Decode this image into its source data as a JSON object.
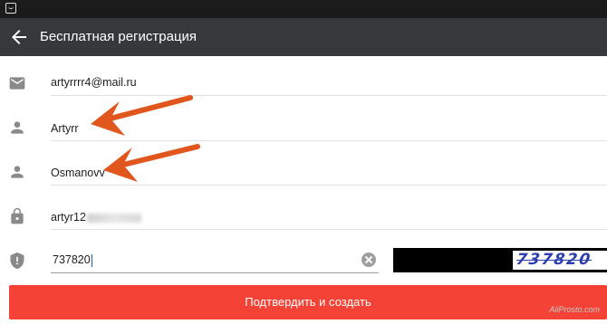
{
  "status_bar": {
    "icon": "android-notification-icon"
  },
  "app_bar": {
    "back_icon": "arrow-back-icon",
    "title": "Бесплатная регистрация"
  },
  "form": {
    "email": {
      "icon": "email-icon",
      "value": "artyrrrr4@mail.ru"
    },
    "first_name": {
      "icon": "person-icon",
      "value": "Artyrr"
    },
    "last_name": {
      "icon": "person-icon",
      "value": "Osmanovv"
    },
    "password": {
      "icon": "lock-icon",
      "value_visible": "artyr12"
    },
    "captcha": {
      "icon": "shield-icon",
      "value": "737820",
      "image_text": "737820",
      "clear_icon": "clear-icon"
    }
  },
  "submit_label": "Подтвердить и создать",
  "watermark": "AliProsto.com",
  "colors": {
    "status_bar": "#1b1b1b",
    "app_bar": "#37383a",
    "submit": "#f44336",
    "annotation_arrow": "#e0561c",
    "captcha_text": "#2b3fb0"
  }
}
